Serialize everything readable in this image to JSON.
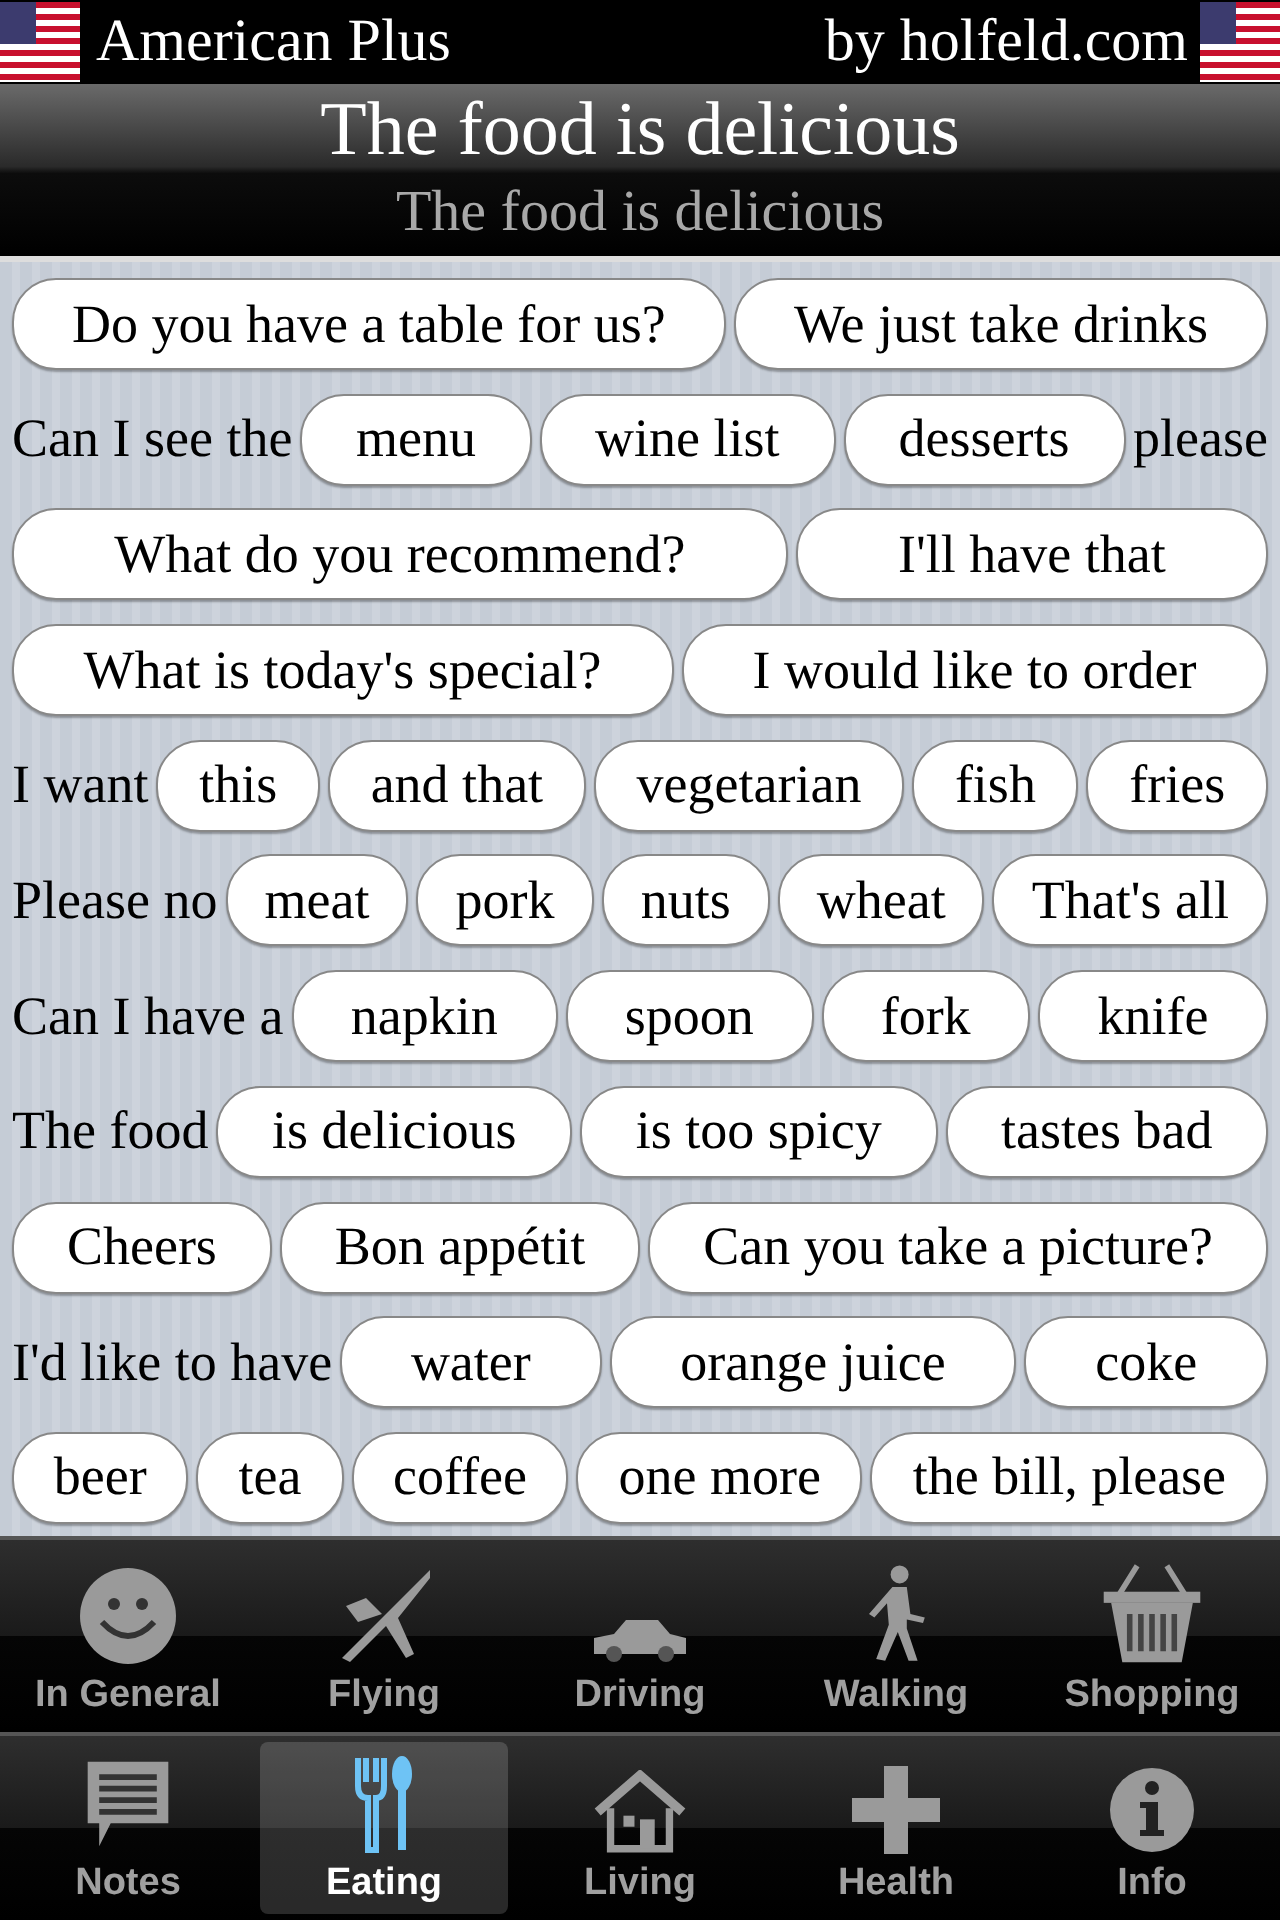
{
  "top_bar": {
    "app_name": "American Plus",
    "credit": "by holfeld.com"
  },
  "title": {
    "main": "The food is delicious",
    "sub": "The food is delicious"
  },
  "phrase_rows": [
    [
      {
        "kind": "button",
        "text": "Do you have a table for us?"
      },
      {
        "kind": "button",
        "text": "We just take drinks"
      }
    ],
    [
      {
        "kind": "label",
        "text": "Can I see the"
      },
      {
        "kind": "button",
        "text": "menu"
      },
      {
        "kind": "button",
        "text": "wine list"
      },
      {
        "kind": "button",
        "text": "desserts"
      },
      {
        "kind": "label",
        "text": "please"
      }
    ],
    [
      {
        "kind": "button",
        "text": "What do you recommend?"
      },
      {
        "kind": "button",
        "text": "I'll have that"
      }
    ],
    [
      {
        "kind": "button",
        "text": "What is today's special?"
      },
      {
        "kind": "button",
        "text": "I would like to order"
      }
    ],
    [
      {
        "kind": "label",
        "text": "I want"
      },
      {
        "kind": "button",
        "text": "this"
      },
      {
        "kind": "button",
        "text": "and that"
      },
      {
        "kind": "button",
        "text": "vegetarian"
      },
      {
        "kind": "button",
        "text": "fish"
      },
      {
        "kind": "button",
        "text": "fries"
      }
    ],
    [
      {
        "kind": "label",
        "text": "Please no"
      },
      {
        "kind": "button",
        "text": "meat"
      },
      {
        "kind": "button",
        "text": "pork"
      },
      {
        "kind": "button",
        "text": "nuts"
      },
      {
        "kind": "button",
        "text": "wheat"
      },
      {
        "kind": "button",
        "text": "That's all"
      }
    ],
    [
      {
        "kind": "label",
        "text": "Can I have a"
      },
      {
        "kind": "button",
        "text": "napkin"
      },
      {
        "kind": "button",
        "text": "spoon"
      },
      {
        "kind": "button",
        "text": "fork"
      },
      {
        "kind": "button",
        "text": "knife"
      }
    ],
    [
      {
        "kind": "label",
        "text": "The food"
      },
      {
        "kind": "button",
        "text": "is delicious"
      },
      {
        "kind": "button",
        "text": "is too spicy"
      },
      {
        "kind": "button",
        "text": "tastes bad"
      }
    ],
    [
      {
        "kind": "button",
        "text": "Cheers"
      },
      {
        "kind": "button",
        "text": "Bon appétit"
      },
      {
        "kind": "button",
        "text": "Can you take a picture?"
      }
    ],
    [
      {
        "kind": "label",
        "text": "I'd like to have"
      },
      {
        "kind": "button",
        "text": "water"
      },
      {
        "kind": "button",
        "text": "orange juice"
      },
      {
        "kind": "button",
        "text": "coke"
      }
    ],
    [
      {
        "kind": "button",
        "text": "beer"
      },
      {
        "kind": "button",
        "text": "tea"
      },
      {
        "kind": "button",
        "text": "coffee"
      },
      {
        "kind": "button",
        "text": "one more"
      },
      {
        "kind": "button",
        "text": "the bill, please"
      }
    ]
  ],
  "category_bar": [
    {
      "label": "In General",
      "selected": false
    },
    {
      "label": "Flying",
      "selected": false
    },
    {
      "label": "Driving",
      "selected": false
    },
    {
      "label": "Walking",
      "selected": false
    },
    {
      "label": "Shopping",
      "selected": false
    }
  ],
  "tab_bar": [
    {
      "label": "Notes",
      "selected": false
    },
    {
      "label": "Eating",
      "selected": true
    },
    {
      "label": "Living",
      "selected": false
    },
    {
      "label": "Health",
      "selected": false
    },
    {
      "label": "Info",
      "selected": false
    }
  ]
}
